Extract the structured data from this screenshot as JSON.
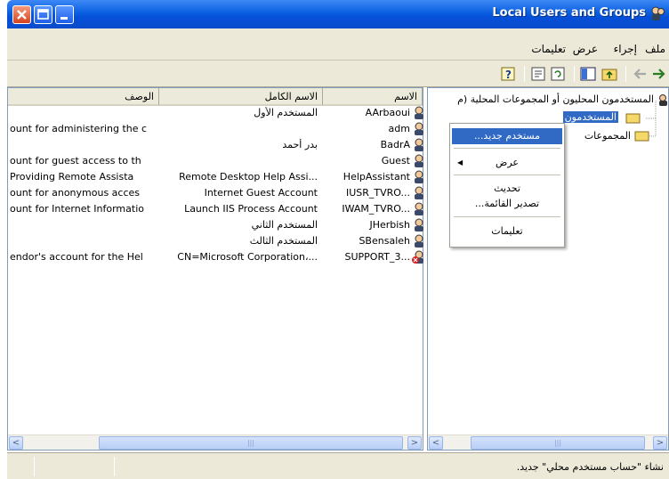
{
  "window": {
    "title": "Local Users and Groups"
  },
  "menu": {
    "file": "ملف",
    "action": "إجراء",
    "view": "عرض",
    "help": "تعليمات"
  },
  "tree": {
    "root": "المستخدمون المحليون أو المجموعات المحلية (م",
    "users": "المستخدمون",
    "groups": "المجموعات"
  },
  "columns": {
    "name": "الاسم",
    "full_name": "الاسم الكامل",
    "description": "الوصف"
  },
  "users": [
    {
      "name": "AArbaoui",
      "full_name": "المستخدم الأول",
      "description": "",
      "disabled": false
    },
    {
      "name": "adm",
      "full_name": "",
      "description": "ount for administering the c",
      "disabled": false
    },
    {
      "name": "BadrA",
      "full_name": "بدر أحمد",
      "description": "",
      "disabled": false
    },
    {
      "name": "Guest",
      "full_name": "",
      "description": "ount for guest access to th",
      "disabled": false
    },
    {
      "name": "HelpAssistant",
      "full_name": "Remote Desktop Help Assi...",
      "description": "Providing Remote Assista",
      "disabled": false
    },
    {
      "name": "IUSR_TVRO...",
      "full_name": "Internet Guest Account",
      "description": "ount for anonymous acces",
      "disabled": false
    },
    {
      "name": "IWAM_TVRO...",
      "full_name": "Launch IIS Process Account",
      "description": "ount for Internet Informatio",
      "disabled": false
    },
    {
      "name": "JHerbish",
      "full_name": "المستخدم الثاني",
      "description": "",
      "disabled": false
    },
    {
      "name": "SBensaleh",
      "full_name": "المستخدم الثالث",
      "description": "",
      "disabled": false
    },
    {
      "name": "SUPPORT_3...",
      "full_name": "CN=Microsoft Corporation،...",
      "description": "endor's account for the Hel",
      "disabled": true
    }
  ],
  "context_menu": {
    "new_user": "مستخدم جديد...",
    "view": "عرض",
    "refresh": "تحديث",
    "export_list": "تصدير القائمة...",
    "help": "تعليمات"
  },
  "status": {
    "text": "نشاء \"حساب مستخدم محلي\" جديد."
  },
  "colors": {
    "title_blue": "#0a5fe0",
    "selection": "#316ac5"
  }
}
